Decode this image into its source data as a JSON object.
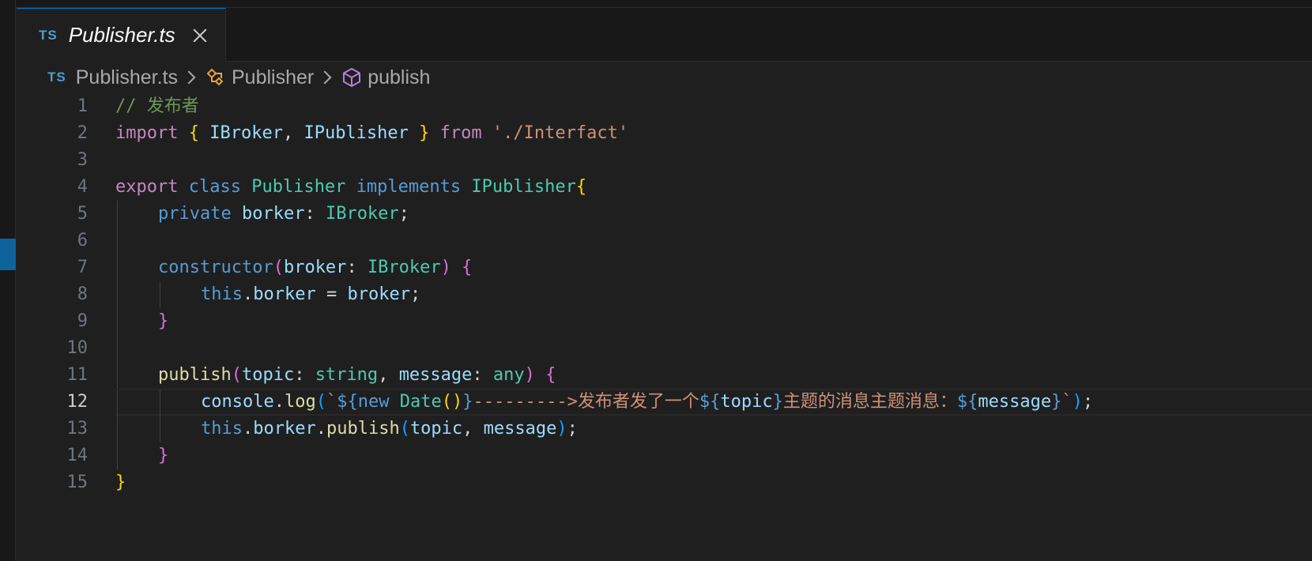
{
  "tab": {
    "badge": "TS",
    "label": "Publisher.ts"
  },
  "breadcrumb": {
    "badge": "TS",
    "file": "Publisher.ts",
    "class": "Publisher",
    "method": "publish"
  },
  "editor": {
    "active_line": 12,
    "line_numbers": [
      "1",
      "2",
      "3",
      "4",
      "5",
      "6",
      "7",
      "8",
      "9",
      "10",
      "11",
      "12",
      "13",
      "14",
      "15"
    ],
    "lines": {
      "l1": {
        "comment": "// 发布者"
      },
      "l2": {
        "import": "import",
        "brace_open": "{",
        "name1": "IBroker",
        "comma": ",",
        "name2": "IPublisher",
        "brace_close": "}",
        "from": "from",
        "path": "'./Interfact'"
      },
      "l4": {
        "export": "export",
        "class": "class",
        "name": "Publisher",
        "implements": "implements",
        "iface": "IPublisher",
        "brace": "{"
      },
      "l5": {
        "private": "private",
        "field": "borker",
        "colon": ":",
        "type": "IBroker",
        "semi": ";"
      },
      "l7": {
        "ctor": "constructor",
        "paren_open": "(",
        "param": "broker",
        "colon": ":",
        "type": "IBroker",
        "paren_close": ")",
        "brace": "{"
      },
      "l8": {
        "this": "this",
        "dot": ".",
        "field": "borker",
        "eq": " = ",
        "value": "broker",
        "semi": ";"
      },
      "l9": {
        "brace": "}"
      },
      "l11": {
        "method": "publish",
        "paren_open": "(",
        "p1": "topic",
        "colon1": ":",
        "t1": "string",
        "comma": ",",
        "p2": "message",
        "colon2": ":",
        "t2": "any",
        "paren_close": ")",
        "brace": "{"
      },
      "l12": {
        "console": "console",
        "dot": ".",
        "log": "log",
        "paren_open": "(",
        "tick": "`",
        "interp1_open": "${",
        "new": "new",
        "date": "Date",
        "call": "()",
        "interp1_close": "}",
        "text1": "--------->发布者发了一个",
        "interp2_open": "${",
        "topic": "topic",
        "interp2_close": "}",
        "text2": "主题的消息主题消息：",
        "interp3_open": "${",
        "message": "message",
        "interp3_close": "}",
        "tick_end": "`",
        "paren_close": ")",
        "semi": ";"
      },
      "l13": {
        "this": "this",
        "dot1": ".",
        "field": "borker",
        "dot2": ".",
        "method": "publish",
        "paren_open": "(",
        "a1": "topic",
        "comma": ",",
        "a2": "message",
        "paren_close": ")",
        "semi": ";"
      },
      "l14": {
        "brace": "}"
      },
      "l15": {
        "brace": "}"
      }
    }
  },
  "colors": {
    "background": "#1f1f1f",
    "comment": "#6a9955",
    "keyword": "#c586c0",
    "storage": "#569cd6",
    "type": "#4ec9b0",
    "variable": "#9cdcfe",
    "function": "#dcdcaa",
    "string": "#ce9178",
    "accent": "#0078d4"
  }
}
